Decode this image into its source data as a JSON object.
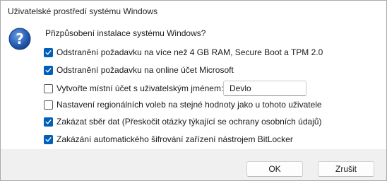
{
  "window": {
    "title": "Uživatelské prostředí systému Windows"
  },
  "dialog": {
    "icon": "question-icon",
    "prompt": "Přizpůsobení instalace systému Windows?",
    "options": [
      {
        "label": "Odstranění požadavku na více než 4 GB RAM, Secure Boot a TPM 2.0",
        "checked": true
      },
      {
        "label": "Odstranění požadavku na online účet Microsoft",
        "checked": true
      },
      {
        "label": "Vytvořte místní účet s uživatelským jménem:",
        "checked": false
      },
      {
        "label": "Nastavení regionálních voleb na stejné hodnoty jako u tohoto uživatele",
        "checked": false
      },
      {
        "label": "Zakázat sběr dat (Přeskočit otázky týkající se ochrany osobních údajů)",
        "checked": true
      },
      {
        "label": "Zakázání automatického šifrování zařízení nástrojem BitLocker",
        "checked": true
      }
    ],
    "username_value": "Devlo"
  },
  "buttons": {
    "ok_label": "OK",
    "cancel_label": "Zrušit"
  },
  "colors": {
    "accent": "#005fb8",
    "icon_blue": "#1e5ca8",
    "footer_bg": "#f0f0f0"
  }
}
